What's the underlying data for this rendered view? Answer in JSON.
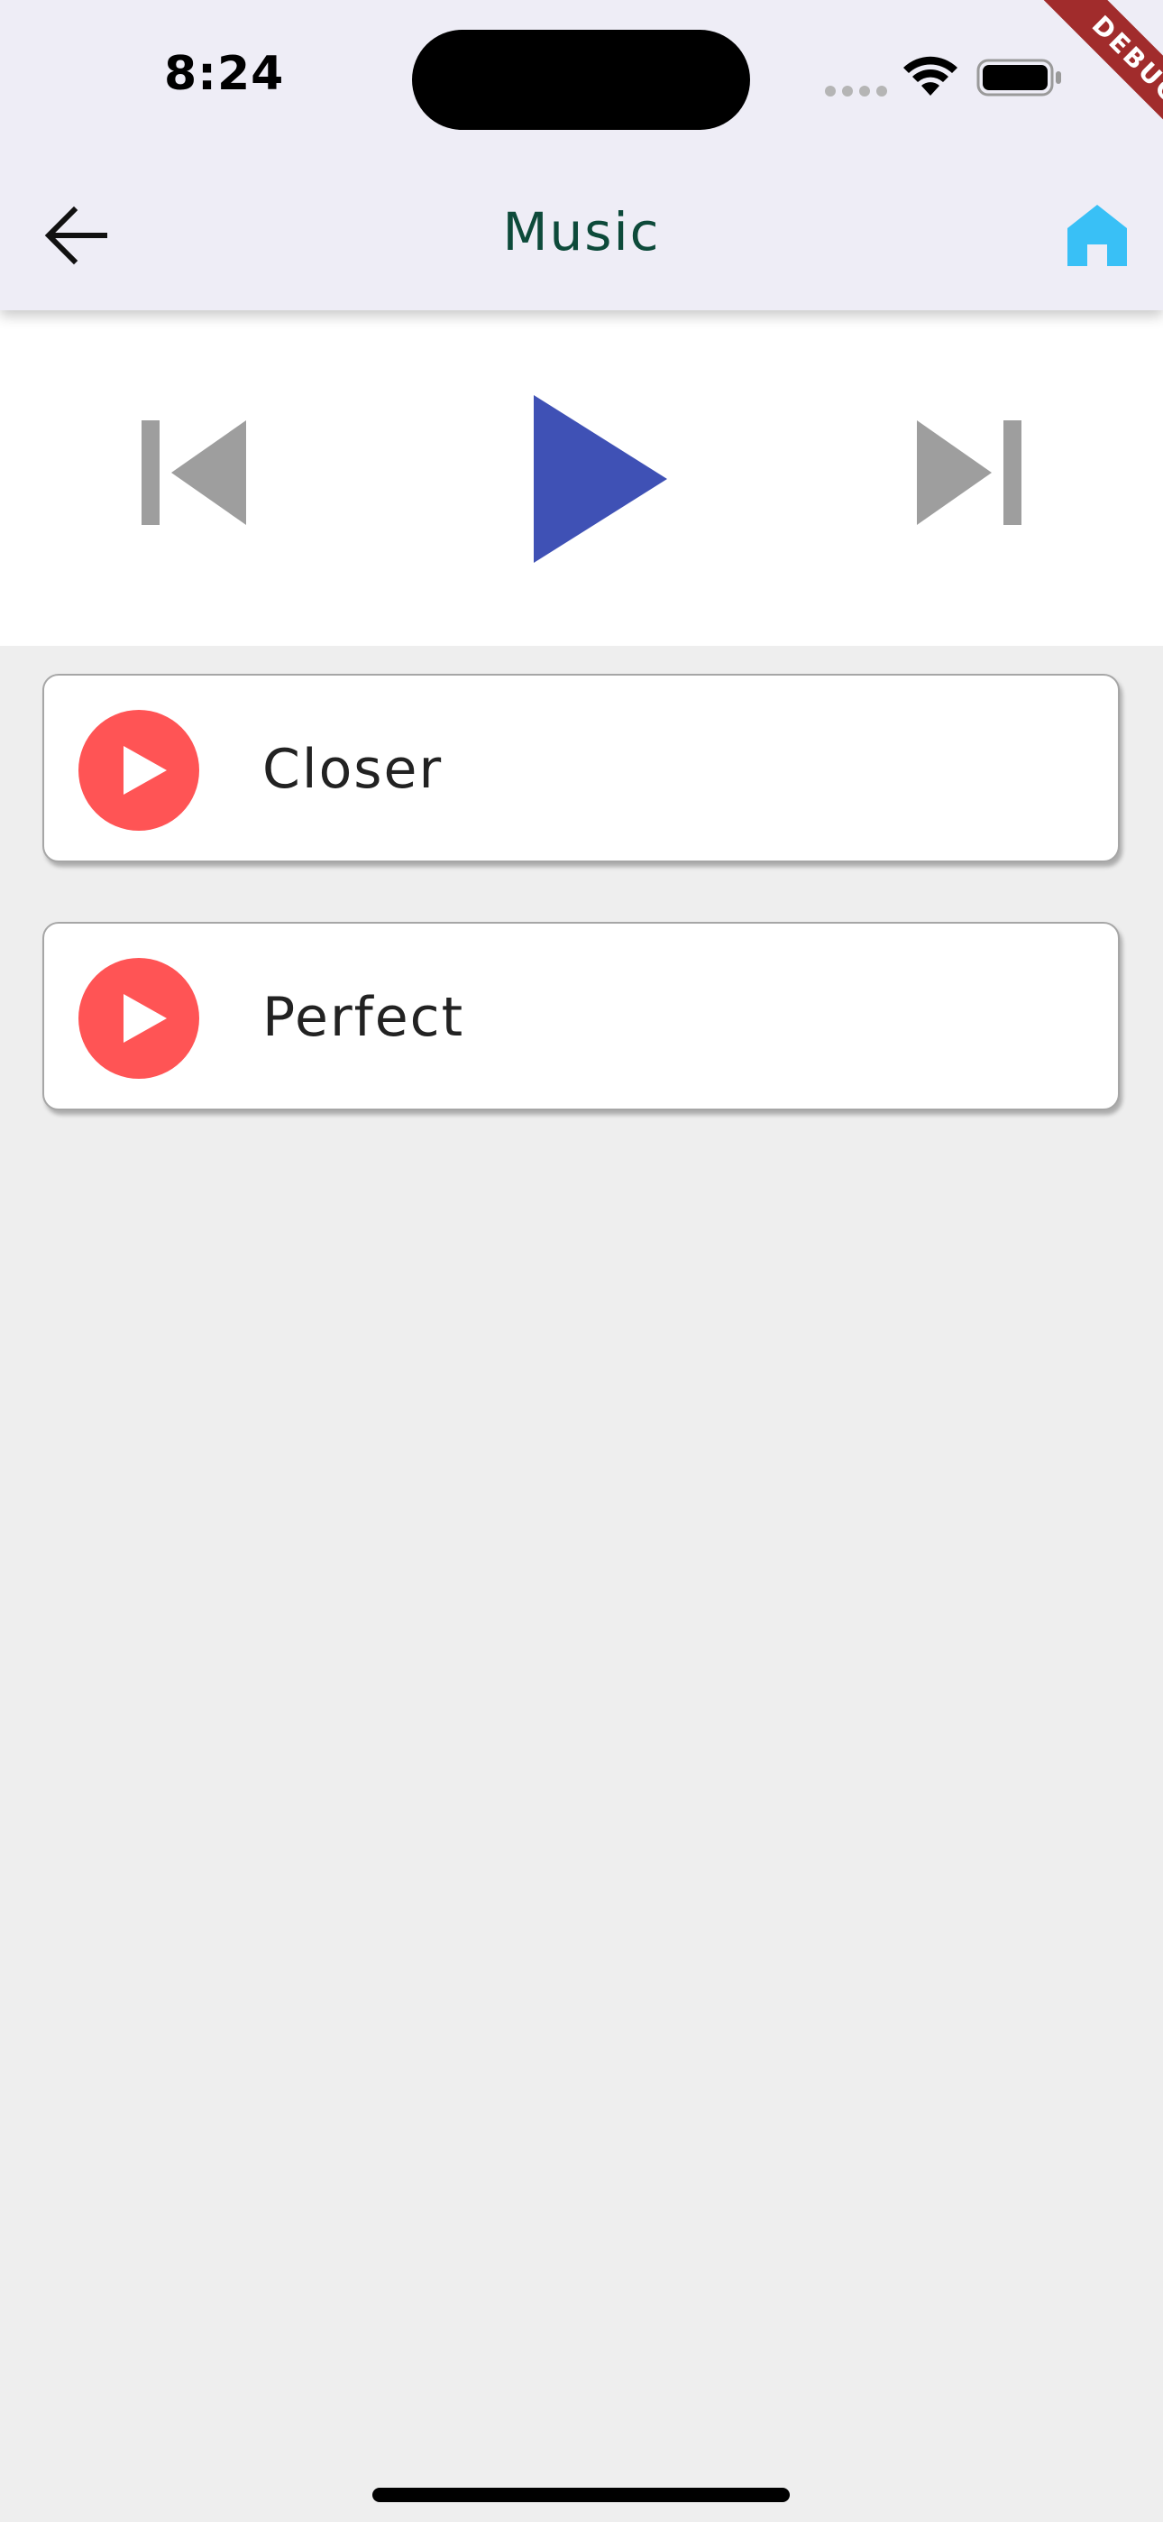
{
  "status_bar": {
    "time": "8:24",
    "icons": [
      "cellular-signal-icon",
      "wifi-icon",
      "battery-icon"
    ]
  },
  "debug_banner": {
    "label": "DEBUG",
    "color": "#a12c2c"
  },
  "app_bar": {
    "title": "Music",
    "back_icon": "arrow-left-icon",
    "home_icon": "home-icon",
    "title_color": "#0d4a3a",
    "home_icon_color": "#39c0f6"
  },
  "player": {
    "controls": [
      {
        "name": "previous",
        "icon": "skip-previous-icon",
        "color": "#9e9e9e"
      },
      {
        "name": "play",
        "icon": "play-icon",
        "color": "#3f51b5"
      },
      {
        "name": "next",
        "icon": "skip-next-icon",
        "color": "#9e9e9e"
      }
    ]
  },
  "songs": [
    {
      "title": "Closer",
      "icon": "play-circle-icon"
    },
    {
      "title": "Perfect",
      "icon": "play-circle-icon"
    }
  ],
  "colors": {
    "background": "#eeeeee",
    "app_bar_background": "#eeedf6",
    "song_icon": "#ff5455"
  }
}
